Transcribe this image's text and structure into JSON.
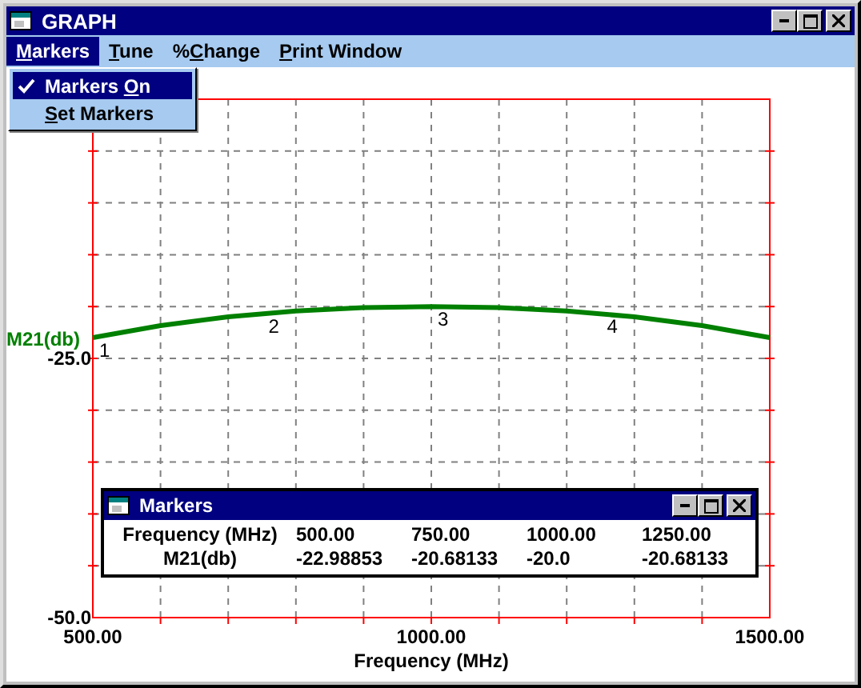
{
  "window": {
    "title": "GRAPH"
  },
  "menu": [
    {
      "key": "M",
      "after": "arkers",
      "selected": true
    },
    {
      "key": "T",
      "after": "une",
      "selected": false
    },
    {
      "before": "%",
      "key": "C",
      "after": "hange",
      "selected": false
    },
    {
      "key": "P",
      "after": "rint Window",
      "selected": false
    }
  ],
  "dropdown": [
    {
      "before": "Markers ",
      "key": "O",
      "after": "n",
      "checked": true,
      "selected": true
    },
    {
      "key": "S",
      "after": "et Markers",
      "checked": false,
      "selected": false
    }
  ],
  "graph": {
    "chart_data": {
      "type": "line",
      "xlabel": "Frequency (MHz)",
      "ylabel": "M21(db)",
      "x": [
        500,
        600,
        700,
        800,
        900,
        1000,
        1100,
        1200,
        1300,
        1400,
        1500
      ],
      "series": [
        {
          "color": "#008000",
          "values": [
            -22.99,
            -21.83,
            -20.99,
            -20.43,
            -20.11,
            -20.0,
            -20.11,
            -20.43,
            -20.99,
            -21.83,
            -22.99
          ]
        }
      ],
      "xlim": [
        500,
        1500
      ],
      "ylim": [
        -50,
        0
      ],
      "xticks": [
        {
          "value": 500,
          "label": "500.00"
        },
        {
          "value": 1000,
          "label": "1000.00"
        },
        {
          "value": 1500,
          "label": "1500.00"
        }
      ],
      "yticks": [
        {
          "value": -25,
          "label": "-25.0"
        },
        {
          "value": -50,
          "label": "-50.0"
        }
      ],
      "annotations": [
        "1",
        "2",
        "3",
        "4"
      ]
    }
  },
  "markers_window": {
    "title": "Markers",
    "rows": [
      {
        "label": "Frequency (MHz)",
        "values": [
          "500.00",
          "750.00",
          "1000.00",
          "1250.00"
        ]
      },
      {
        "label": "M21(db)",
        "values": [
          "-22.98853",
          "-20.68133",
          "-20.0",
          "-20.68133"
        ]
      }
    ]
  }
}
